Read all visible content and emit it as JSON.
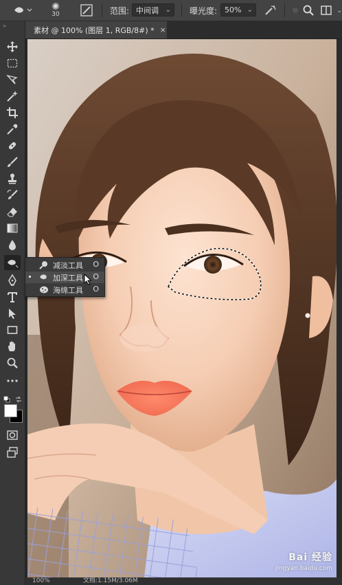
{
  "options_bar": {
    "brush_size": "30",
    "range_label": "范围:",
    "range_value": "中间调",
    "exposure_label": "曝光度:",
    "exposure_value": "50%"
  },
  "tools": [
    {
      "name": "move-tool",
      "icon": "move-icon"
    },
    {
      "name": "marquee-tool",
      "icon": "marquee-icon"
    },
    {
      "name": "lasso-tool",
      "icon": "lasso-icon"
    },
    {
      "name": "magic-wand-tool",
      "icon": "magic-wand-icon"
    },
    {
      "name": "crop-tool",
      "icon": "crop-icon"
    },
    {
      "name": "eyedropper-tool",
      "icon": "eyedropper-icon"
    },
    {
      "name": "healing-brush-tool",
      "icon": "bandage-icon"
    },
    {
      "name": "brush-tool",
      "icon": "brush-icon"
    },
    {
      "name": "clone-stamp-tool",
      "icon": "stamp-icon"
    },
    {
      "name": "history-brush-tool",
      "icon": "history-brush-icon"
    },
    {
      "name": "eraser-tool",
      "icon": "eraser-icon"
    },
    {
      "name": "gradient-tool",
      "icon": "gradient-icon"
    },
    {
      "name": "blur-tool",
      "icon": "drop-icon"
    },
    {
      "name": "burn-tool",
      "icon": "burn-icon"
    },
    {
      "name": "pen-tool",
      "icon": "pen-icon"
    },
    {
      "name": "type-tool",
      "icon": "type-icon"
    },
    {
      "name": "path-selection-tool",
      "icon": "arrow-icon"
    },
    {
      "name": "rectangle-tool",
      "icon": "rectangle-icon"
    },
    {
      "name": "hand-tool",
      "icon": "hand-icon"
    },
    {
      "name": "zoom-tool",
      "icon": "zoom-icon"
    },
    {
      "name": "edit-toolbar",
      "icon": "more-icon"
    }
  ],
  "document": {
    "tab_title": "素材 @ 100% (图层 1, RGB/8#) *",
    "close_glyph": "×"
  },
  "flyout": {
    "items": [
      {
        "label": "减淡工具",
        "shortcut": "O",
        "icon": "dodge-icon",
        "selected": false
      },
      {
        "label": "加深工具",
        "shortcut": "O",
        "icon": "burn-icon",
        "selected": true
      },
      {
        "label": "海绵工具",
        "shortcut": "O",
        "icon": "sponge-icon",
        "selected": false
      }
    ]
  },
  "status_bar": {
    "zoom": "100%",
    "doc_size": "文档:1.15M/3.06M"
  },
  "watermark": {
    "main": "Bai 经验",
    "sub": "jingyan.baidu.com"
  },
  "colors": {
    "foreground": "#ffffff",
    "background": "#000000"
  }
}
